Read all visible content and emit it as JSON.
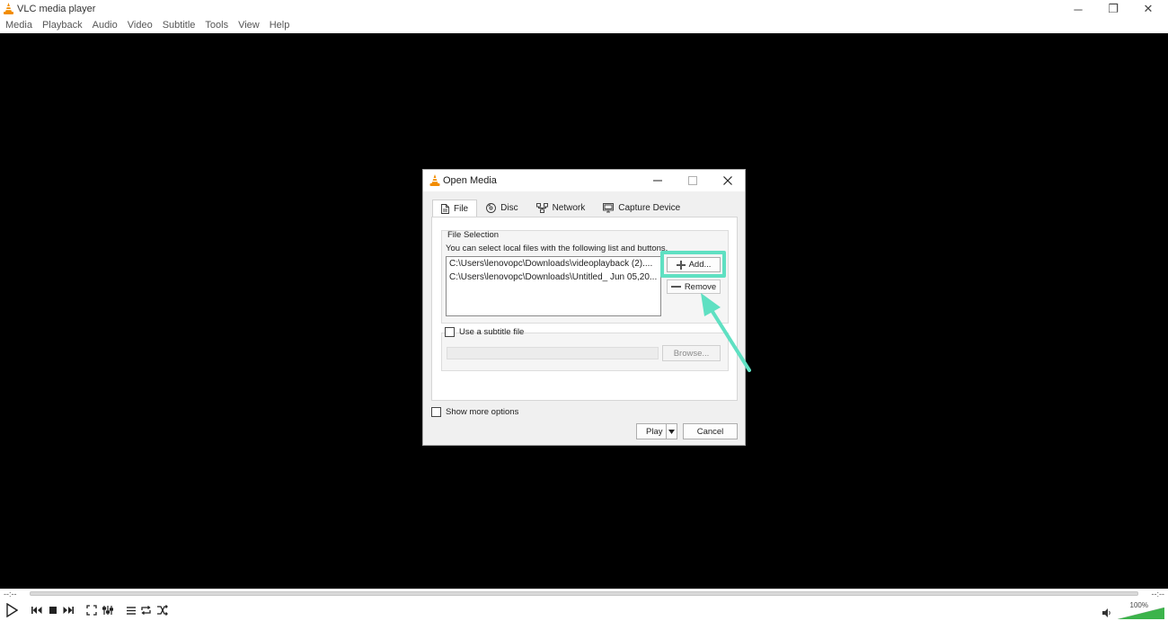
{
  "window": {
    "title": "VLC media player",
    "minimize_glyph": "─",
    "restore_glyph": "❐",
    "close_glyph": "✕"
  },
  "menu": {
    "items": [
      "Media",
      "Playback",
      "Audio",
      "Video",
      "Subtitle",
      "Tools",
      "View",
      "Help"
    ]
  },
  "seekbar": {
    "elapsed": "--:--",
    "remaining": "--:--"
  },
  "volume": {
    "percent_label": "100%",
    "level": 1.0
  },
  "dialog": {
    "title": "Open Media",
    "tabs": [
      {
        "label": "File",
        "icon": "file-icon",
        "active": true
      },
      {
        "label": "Disc",
        "icon": "disc-icon",
        "active": false
      },
      {
        "label": "Network",
        "icon": "network-icon",
        "active": false
      },
      {
        "label": "Capture Device",
        "icon": "capture-device-icon",
        "active": false
      }
    ],
    "file_selection": {
      "legend": "File Selection",
      "help": "You can select local files with the following list and buttons.",
      "files": [
        "C:\\Users\\lenovopc\\Downloads\\videoplayback (2)....",
        "C:\\Users\\lenovopc\\Downloads\\Untitled_ Jun 05,20..."
      ],
      "add_label": "Add...",
      "remove_label": "Remove"
    },
    "subtitle": {
      "checkbox_label": "Use a subtitle file",
      "checked": false,
      "path_value": "",
      "browse_label": "Browse..."
    },
    "more_options": {
      "label": "Show more options",
      "checked": false
    },
    "play_label": "Play",
    "cancel_label": "Cancel"
  },
  "colors": {
    "highlight": "#5fe0c2",
    "video_bg": "#000000",
    "vlc_orange": "#f28c00",
    "volume_green": "#3cb44b"
  }
}
